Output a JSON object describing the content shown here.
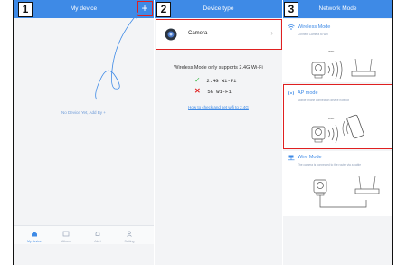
{
  "steps": [
    "1",
    "2",
    "3"
  ],
  "panel1": {
    "title": "My device",
    "add_symbol": "+",
    "empty_message": "No Device Yet, Add By +",
    "tabs": [
      {
        "label": "My device",
        "icon": "home-icon",
        "active": true
      },
      {
        "label": "Album",
        "icon": "album-icon",
        "active": false
      },
      {
        "label": "Alert",
        "icon": "bell-icon",
        "active": false
      },
      {
        "label": "Setting",
        "icon": "person-icon",
        "active": false
      }
    ]
  },
  "panel2": {
    "title": "Device type",
    "camera_label": "Camera",
    "notice": "Wireless Mode only supports 2.4G Wi-Fi",
    "ok_mark": "✓",
    "ok_label": "2.4G Wi-Fi",
    "bad_mark": "✕",
    "bad_label": "5G Wi-Fi",
    "help_link": "How to check and set wifi to 2.4G"
  },
  "panel3": {
    "title": "Network Mode",
    "modes": [
      {
        "title": "Wireless Mode",
        "desc": "Connect Camera to Wifi"
      },
      {
        "title": "AP mode",
        "desc": "Mobile phone connection device hotspot"
      },
      {
        "title": "Wire Mode",
        "desc": "The camera is connected to the router via a cable"
      }
    ],
    "ap_ssid": "WIFI",
    "wifi_ssid": "WIFI"
  },
  "colors": {
    "header": "#3e8ae6",
    "highlight": "#e02020",
    "ok": "#3db94a",
    "bad": "#e02020"
  }
}
